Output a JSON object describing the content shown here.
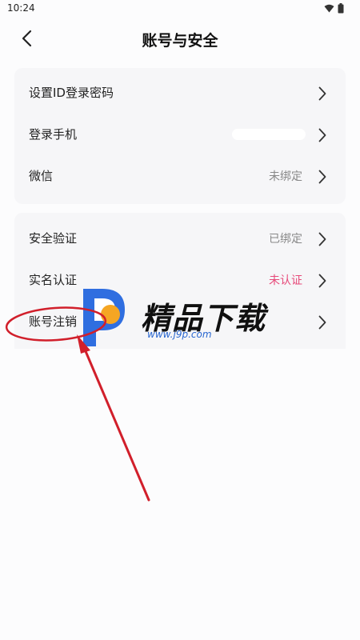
{
  "status": {
    "time": "10:24"
  },
  "header": {
    "title": "账号与安全"
  },
  "card1": {
    "items": [
      {
        "label": "设置ID登录密码",
        "value": ""
      },
      {
        "label": "登录手机",
        "value": ""
      },
      {
        "label": "微信",
        "value": "未绑定"
      }
    ]
  },
  "card2": {
    "items": [
      {
        "label": "安全验证",
        "value": "已绑定"
      },
      {
        "label": "实名认证",
        "value": "未认证"
      },
      {
        "label": "账号注销",
        "value": ""
      }
    ]
  },
  "watermark": {
    "title": "精品下载",
    "url": "www.j9p.com"
  },
  "colors": {
    "warn": "#e74a7a",
    "annotation": "#d11f2b",
    "logo_blue": "#2f6ee0",
    "logo_orange": "#f5a623"
  }
}
